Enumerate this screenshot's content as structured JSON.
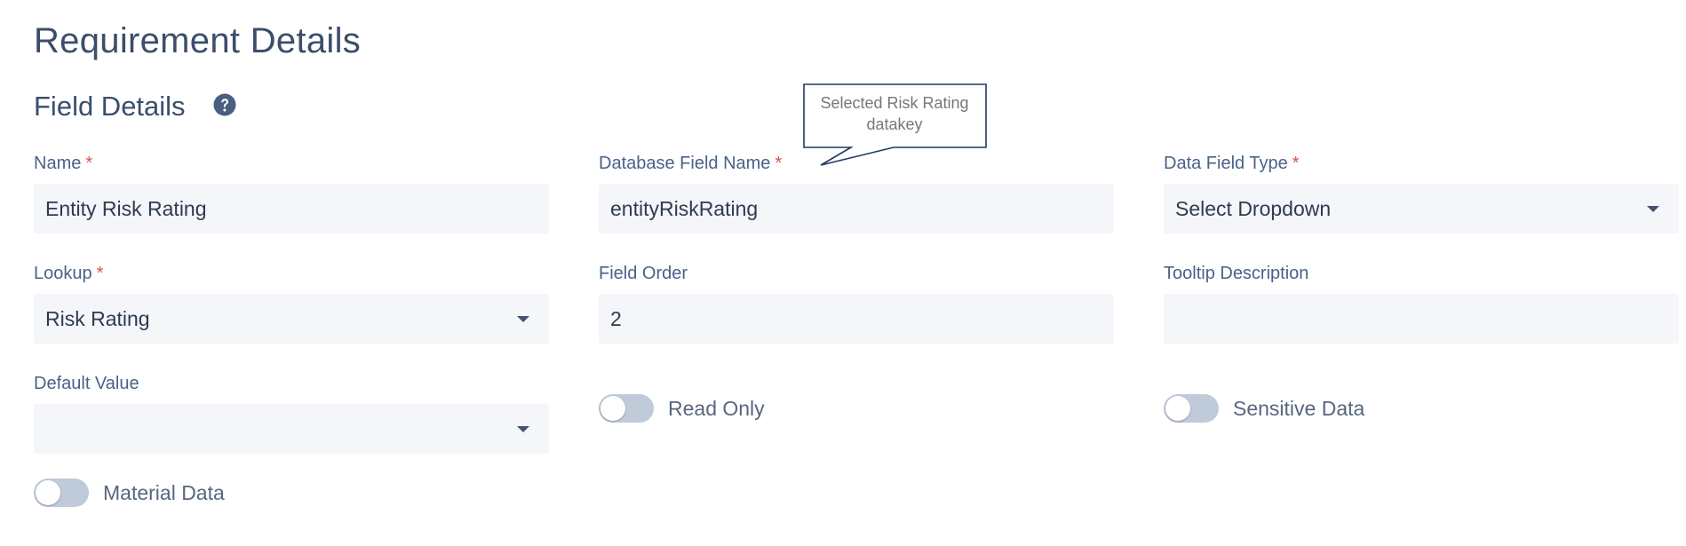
{
  "page": {
    "title": "Requirement Details"
  },
  "section": {
    "title": "Field Details",
    "help_icon": "question-circle-icon"
  },
  "required_marker": "*",
  "fields": {
    "name": {
      "label": "Name",
      "value": "Entity Risk Rating"
    },
    "db_field_name": {
      "label": "Database Field Name",
      "value": "entityRiskRating"
    },
    "data_field_type": {
      "label": "Data Field Type",
      "value": "Select Dropdown"
    },
    "lookup": {
      "label": "Lookup",
      "value": "Risk Rating"
    },
    "field_order": {
      "label": "Field Order",
      "value": "2"
    },
    "tooltip_description": {
      "label": "Tooltip Description",
      "value": ""
    },
    "default_value": {
      "label": "Default Value",
      "value": ""
    }
  },
  "toggles": {
    "read_only": {
      "label": "Read Only",
      "on": false
    },
    "sensitive_data": {
      "label": "Sensitive Data",
      "on": false
    },
    "material_data": {
      "label": "Material Data",
      "on": false
    }
  },
  "callout": {
    "line1": "Selected Risk Rating",
    "line2": "datakey"
  },
  "colors": {
    "title": "#3b4e6b",
    "label": "#4a6287",
    "required": "#d9534f",
    "input_bg": "#f4f6f9",
    "toggle_off": "#bfcbd8",
    "callout_border": "#1f3864"
  }
}
